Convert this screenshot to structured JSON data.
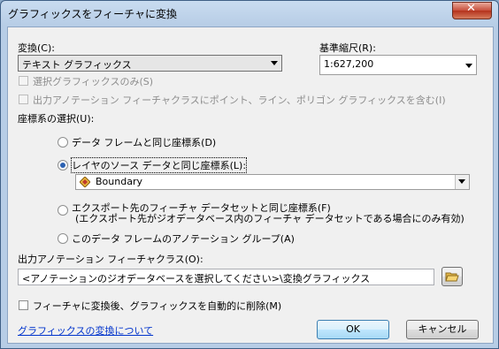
{
  "window": {
    "title": "グラフィックスをフィーチャに変換"
  },
  "conversion": {
    "label": "変換(C):",
    "value": "テキスト グラフィックス"
  },
  "scale": {
    "label": "基準縮尺(R):",
    "value": "1:627,200"
  },
  "options": {
    "selected_only": "選択グラフィックスのみ(S)",
    "output_annotation": "出力アノテーション フィーチャクラスにポイント、ライン、ポリゴン グラフィックスを含む(I)"
  },
  "coord_system": {
    "label": "座標系の選択(U):",
    "same_as_frame": "データ フレームと同じ座標系(D)",
    "same_as_layer": "レイヤのソース データと同じ座標系(L):",
    "layer_value": "Boundary",
    "same_as_export_line1": "エクスポート先のフィーチャ データセットと同じ座標系(F)",
    "same_as_export_line2": "(エクスポート先がジオデータベース内のフィーチャ データセットである場合にのみ有効)",
    "annotation_group": "このデータ フレームのアノテーション グループ(A)"
  },
  "output": {
    "label": "出力アノテーション フィーチャクラス(O):",
    "value": "<アノテーションのジオデータベースを選択してください>\\変換グラフィックス"
  },
  "delete_after": "フィーチャに変換後、グラフィックスを自動的に削除(M)",
  "help_link": "グラフィックスの変換について",
  "buttons": {
    "ok": "OK",
    "cancel": "キャンセル"
  },
  "icons": {
    "close": "close-icon",
    "layer": "layer-icon",
    "folder": "open-folder-icon"
  },
  "colors": {
    "title_bar": "#b7cde6",
    "close": "#c74e3a",
    "link": "#0033cc",
    "radio_selected": "#2c62b2"
  }
}
